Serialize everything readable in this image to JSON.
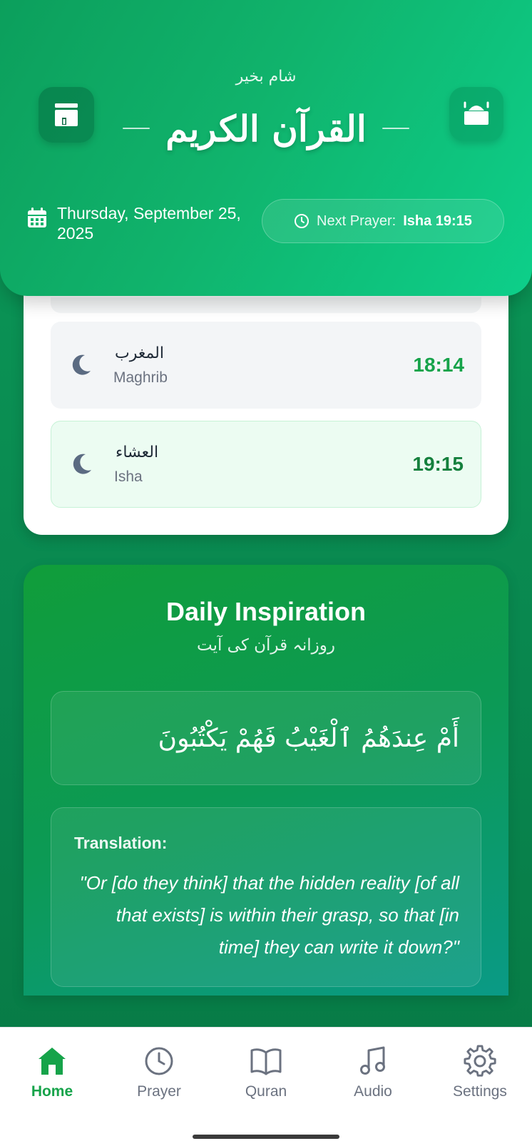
{
  "header": {
    "greeting": "شام بخیر",
    "title": "القرآن الكريم",
    "date_line1": "Thursday, September 25,",
    "date_line2": "2025",
    "next_prayer_label": "Next Prayer:",
    "next_prayer_value": "Isha 19:15"
  },
  "prayers": [
    {
      "arabic": "المغرب",
      "english": "Maghrib",
      "time": "18:14",
      "icon": "moon-icon"
    },
    {
      "arabic": "العشاء",
      "english": "Isha",
      "time": "19:15",
      "icon": "moon-icon",
      "active": true
    }
  ],
  "inspiration": {
    "title": "Daily Inspiration",
    "subtitle": "روزانہ قرآن کی آیت",
    "verse": "أَمْ عِندَهُمُ ٱلْغَيْبُ فَهُمْ يَكْتُبُونَ",
    "translation_label": "Translation:",
    "translation": "\"Or [do they think] that the hidden reality [of all that exists] is within their grasp, so that [in time] they can write it down?\""
  },
  "nav": [
    {
      "label": "Home",
      "icon": "home-icon",
      "active": true
    },
    {
      "label": "Prayer",
      "icon": "clock-icon"
    },
    {
      "label": "Quran",
      "icon": "book-icon"
    },
    {
      "label": "Audio",
      "icon": "music-icon"
    },
    {
      "label": "Settings",
      "icon": "gear-icon"
    }
  ],
  "colors": {
    "primary": "#16a34a",
    "header_gradient_start": "#0c9f5c",
    "header_gradient_end": "#0dcf8a"
  }
}
